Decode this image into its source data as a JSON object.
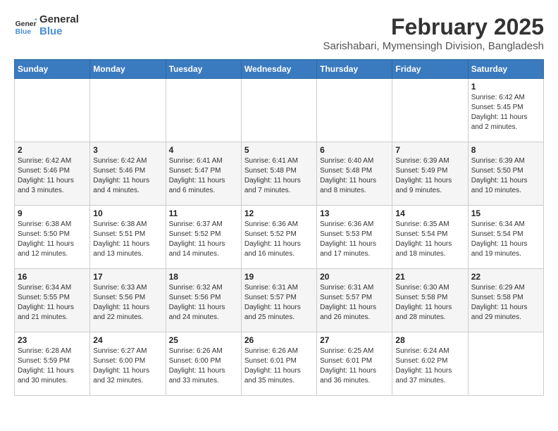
{
  "logo": {
    "line1": "General",
    "line2": "Blue"
  },
  "title": "February 2025",
  "subtitle": "Sarishabari, Mymensingh Division, Bangladesh",
  "weekdays": [
    "Sunday",
    "Monday",
    "Tuesday",
    "Wednesday",
    "Thursday",
    "Friday",
    "Saturday"
  ],
  "weeks": [
    [
      {
        "day": "",
        "info": ""
      },
      {
        "day": "",
        "info": ""
      },
      {
        "day": "",
        "info": ""
      },
      {
        "day": "",
        "info": ""
      },
      {
        "day": "",
        "info": ""
      },
      {
        "day": "",
        "info": ""
      },
      {
        "day": "1",
        "info": "Sunrise: 6:42 AM\nSunset: 5:45 PM\nDaylight: 11 hours and 2 minutes."
      }
    ],
    [
      {
        "day": "2",
        "info": "Sunrise: 6:42 AM\nSunset: 5:46 PM\nDaylight: 11 hours and 3 minutes."
      },
      {
        "day": "3",
        "info": "Sunrise: 6:42 AM\nSunset: 5:46 PM\nDaylight: 11 hours and 4 minutes."
      },
      {
        "day": "4",
        "info": "Sunrise: 6:41 AM\nSunset: 5:47 PM\nDaylight: 11 hours and 6 minutes."
      },
      {
        "day": "5",
        "info": "Sunrise: 6:41 AM\nSunset: 5:48 PM\nDaylight: 11 hours and 7 minutes."
      },
      {
        "day": "6",
        "info": "Sunrise: 6:40 AM\nSunset: 5:48 PM\nDaylight: 11 hours and 8 minutes."
      },
      {
        "day": "7",
        "info": "Sunrise: 6:39 AM\nSunset: 5:49 PM\nDaylight: 11 hours and 9 minutes."
      },
      {
        "day": "8",
        "info": "Sunrise: 6:39 AM\nSunset: 5:50 PM\nDaylight: 11 hours and 10 minutes."
      }
    ],
    [
      {
        "day": "9",
        "info": "Sunrise: 6:38 AM\nSunset: 5:50 PM\nDaylight: 11 hours and 12 minutes."
      },
      {
        "day": "10",
        "info": "Sunrise: 6:38 AM\nSunset: 5:51 PM\nDaylight: 11 hours and 13 minutes."
      },
      {
        "day": "11",
        "info": "Sunrise: 6:37 AM\nSunset: 5:52 PM\nDaylight: 11 hours and 14 minutes."
      },
      {
        "day": "12",
        "info": "Sunrise: 6:36 AM\nSunset: 5:52 PM\nDaylight: 11 hours and 16 minutes."
      },
      {
        "day": "13",
        "info": "Sunrise: 6:36 AM\nSunset: 5:53 PM\nDaylight: 11 hours and 17 minutes."
      },
      {
        "day": "14",
        "info": "Sunrise: 6:35 AM\nSunset: 5:54 PM\nDaylight: 11 hours and 18 minutes."
      },
      {
        "day": "15",
        "info": "Sunrise: 6:34 AM\nSunset: 5:54 PM\nDaylight: 11 hours and 19 minutes."
      }
    ],
    [
      {
        "day": "16",
        "info": "Sunrise: 6:34 AM\nSunset: 5:55 PM\nDaylight: 11 hours and 21 minutes."
      },
      {
        "day": "17",
        "info": "Sunrise: 6:33 AM\nSunset: 5:56 PM\nDaylight: 11 hours and 22 minutes."
      },
      {
        "day": "18",
        "info": "Sunrise: 6:32 AM\nSunset: 5:56 PM\nDaylight: 11 hours and 24 minutes."
      },
      {
        "day": "19",
        "info": "Sunrise: 6:31 AM\nSunset: 5:57 PM\nDaylight: 11 hours and 25 minutes."
      },
      {
        "day": "20",
        "info": "Sunrise: 6:31 AM\nSunset: 5:57 PM\nDaylight: 11 hours and 26 minutes."
      },
      {
        "day": "21",
        "info": "Sunrise: 6:30 AM\nSunset: 5:58 PM\nDaylight: 11 hours and 28 minutes."
      },
      {
        "day": "22",
        "info": "Sunrise: 6:29 AM\nSunset: 5:58 PM\nDaylight: 11 hours and 29 minutes."
      }
    ],
    [
      {
        "day": "23",
        "info": "Sunrise: 6:28 AM\nSunset: 5:59 PM\nDaylight: 11 hours and 30 minutes."
      },
      {
        "day": "24",
        "info": "Sunrise: 6:27 AM\nSunset: 6:00 PM\nDaylight: 11 hours and 32 minutes."
      },
      {
        "day": "25",
        "info": "Sunrise: 6:26 AM\nSunset: 6:00 PM\nDaylight: 11 hours and 33 minutes."
      },
      {
        "day": "26",
        "info": "Sunrise: 6:26 AM\nSunset: 6:01 PM\nDaylight: 11 hours and 35 minutes."
      },
      {
        "day": "27",
        "info": "Sunrise: 6:25 AM\nSunset: 6:01 PM\nDaylight: 11 hours and 36 minutes."
      },
      {
        "day": "28",
        "info": "Sunrise: 6:24 AM\nSunset: 6:02 PM\nDaylight: 11 hours and 37 minutes."
      },
      {
        "day": "",
        "info": ""
      }
    ]
  ]
}
